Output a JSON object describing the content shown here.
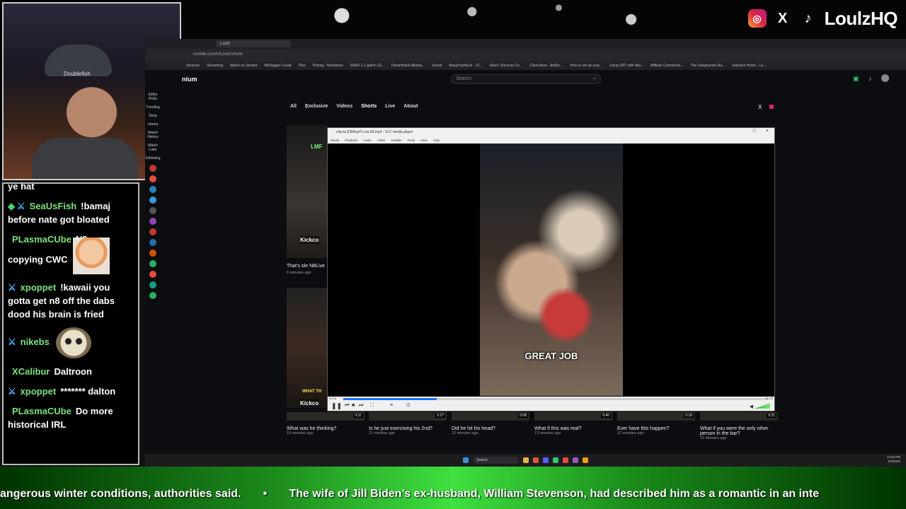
{
  "social": {
    "instagram": "instagram-icon",
    "x": "X",
    "tiktok": "♪",
    "handle": "LoulzHQ"
  },
  "webcam": {
    "cap_text": "Doublefish"
  },
  "chat": {
    "partial_top": "ye hat",
    "messages": [
      {
        "user": "SeaUsFish",
        "text": "!bamaj before nate got bloated",
        "badges": [
          "gem",
          "sword"
        ]
      },
      {
        "user": "PLasmaCUbe",
        "text": "N8 was copying CWC",
        "emote": "trump"
      },
      {
        "user": "xpoppet",
        "text": "!kawaii you gotta get n8 off the dabs dood his brain is fried",
        "badges": [
          "sword"
        ]
      },
      {
        "user": "nikebs",
        "text": "",
        "emote": "sloth",
        "badges": [
          "sword"
        ]
      },
      {
        "user": "XCalibur",
        "text": "Daltroon"
      },
      {
        "user": "xpoppet",
        "text": "******* dalton",
        "badges": [
          "sword"
        ]
      },
      {
        "user": "PLasmaCUbe",
        "text": "Do more historical IRL"
      }
    ]
  },
  "browser": {
    "tab_title": "Loulz",
    "url": "rumble.com/c/Loulz/shorts",
    "bookmarks": [
      "Services",
      "Streaming",
      "Watch on Stream",
      "McNugget Caviar",
      "Plex",
      "Pricing - Streamrun",
      "RM43-2 1-gallon 32...",
      "DreamHack Atlanta...",
      "Saved",
      "BangYourBuck - 32...",
      "Skool: Discover Co...",
      "Client Area - AntiSc...",
      "How to set up your...",
      "Using SRT with Mel...",
      "Affiliate Commissio...",
      "The Fairgrounds Na...",
      "Subsack Home - Lo..."
    ],
    "logo_fragment": "nium",
    "search_placeholder": "Search",
    "left_nav": [
      "Editor Picks",
      "Trending",
      "Shop",
      "Library",
      "Watch History",
      "Watch Later",
      "Following"
    ],
    "channel_tabs": [
      "All",
      "Exclusive",
      "Videos",
      "Shorts",
      "Live",
      "About"
    ],
    "thumb_overlay": "LMF",
    "kick_label": "Kickco",
    "left_video": {
      "title": "That's ole N8Live",
      "meta": "6 minutes ago"
    },
    "bottom_videos": [
      {
        "title": "What was he thinking?",
        "meta": "10 minutes ago",
        "duration": "0:31"
      },
      {
        "title": "Is he just exercising his 2nd?",
        "meta": "11 minutes ago",
        "duration": "0:27"
      },
      {
        "title": "Did he hit his head?",
        "meta": "12 minutes ago",
        "duration": "0:08"
      },
      {
        "title": "What if this was real?",
        "meta": "13 minutes ago",
        "duration": "0:40"
      },
      {
        "title": "Ever have this happen?",
        "meta": "12 minutes ago",
        "duration": "0:18"
      },
      {
        "title": "What if you were the only other person in the bar?",
        "meta": "15 minutes ago",
        "duration": "0:31"
      }
    ],
    "left_thumb2_text": "WHAT TH"
  },
  "vlc": {
    "title": "clip.hz,f(J84vgY1.ros.00.mp4 - VLC media player",
    "menu": [
      "Media",
      "Playback",
      "Audio",
      "Video",
      "Subtitle",
      "Tools",
      "View",
      "Help"
    ],
    "caption": "GREAT JOB",
    "time_current": "00:05",
    "time_total": "00:28",
    "progress": 0.22
  },
  "taskbar": {
    "search_label": "Search",
    "time": "13:03 PM",
    "date": "2/4/2026"
  },
  "ticker": {
    "text": "angerous winter conditions, authorities said.       •       The wife of Jill Biden’s ex-husband, William Stevenson, had described him as a romantic in an inte"
  }
}
